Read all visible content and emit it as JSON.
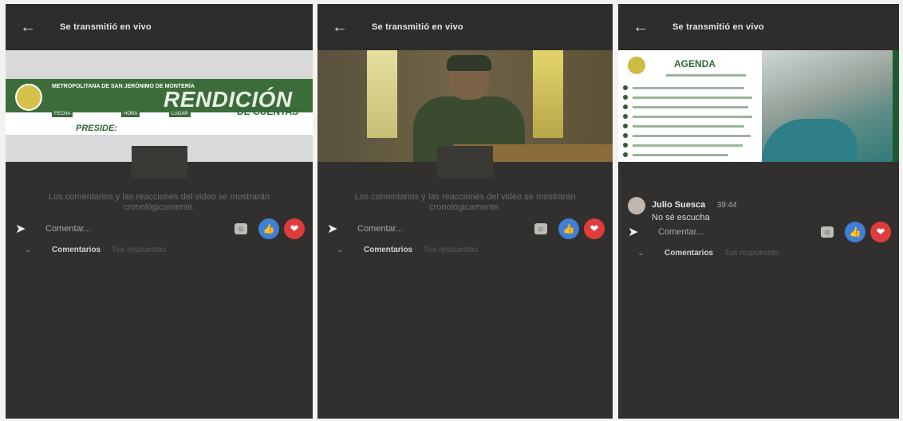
{
  "panels": [
    {
      "header_title": "Se transmitió en vivo",
      "note": "Los comentarios y las reacciones del video se mostrarán cronológicamente.",
      "comment_label": "Comentar...",
      "tabs": {
        "comments": "Comentarios",
        "replies": "Tus respuestas"
      },
      "banner": {
        "org": "METROPOLITANA DE SAN JERÓNIMO DE MONTERÍA",
        "title": "RENDICIÓN",
        "subtitle": "DE CUENTAS",
        "preside": "PRESIDE:",
        "chip_date": "FECHA",
        "chip_time": "HORA",
        "chip_place": "LUGAR"
      }
    },
    {
      "header_title": "Se transmitió en vivo",
      "note": "Los comentarios y las reacciones del video se mostrarán cronológicamente.",
      "comment_label": "Comentar...",
      "tabs": {
        "comments": "Comentarios",
        "replies": "Tus respuestas"
      }
    },
    {
      "header_title": "Se transmitió en vivo",
      "agenda_title": "AGENDA",
      "comment": {
        "author": "Julio Suesca",
        "time": "39:44",
        "text": "No sé escucha"
      },
      "comment_label": "Comentar...",
      "tabs": {
        "comments": "Comentarios",
        "replies": "Tus respuestas"
      }
    }
  ],
  "icons": {
    "back": "arrow-left-icon",
    "share": "share-arrow-icon",
    "emoji": "emoji-icon",
    "like": "like-icon",
    "love": "love-icon",
    "chevron": "chevron-down-icon"
  },
  "colors": {
    "like": "#3f7fd6",
    "love": "#e03c3c",
    "banner_green": "#3c6c3a"
  }
}
